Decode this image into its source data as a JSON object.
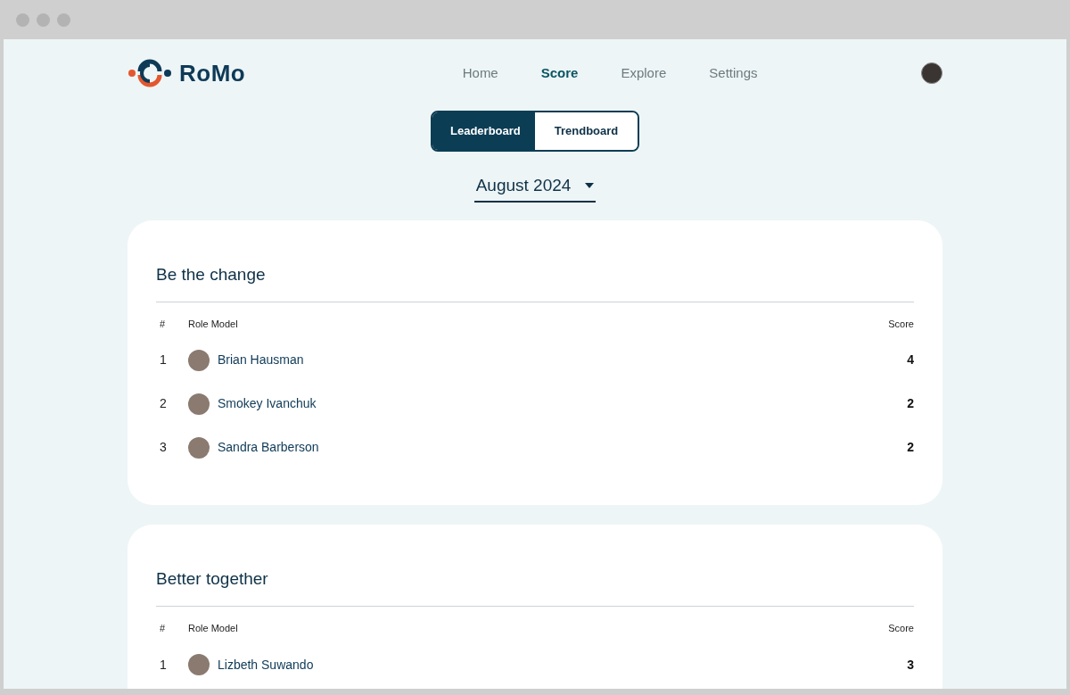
{
  "brand": {
    "name": "RoMo"
  },
  "nav": [
    {
      "label": "Home",
      "selected": false
    },
    {
      "label": "Score",
      "selected": true
    },
    {
      "label": "Explore",
      "selected": false
    },
    {
      "label": "Settings",
      "selected": false
    }
  ],
  "tabs": [
    {
      "label": "Leaderboard",
      "selected": true
    },
    {
      "label": "Trendboard",
      "selected": false
    }
  ],
  "period": {
    "value": "August 2024"
  },
  "boards": [
    {
      "title": "Be the change",
      "columns": [
        "#",
        "Role Model",
        "Score"
      ],
      "rows": [
        {
          "rank": "1",
          "name": "Brian Hausman",
          "score": "4"
        },
        {
          "rank": "2",
          "name": "Smokey Ivanchuk",
          "score": "2"
        },
        {
          "rank": "3",
          "name": "Sandra Barberson",
          "score": "2"
        }
      ]
    },
    {
      "title": "Better together",
      "columns": [
        "#",
        "Role Model",
        "Score"
      ],
      "rows": [
        {
          "rank": "1",
          "name": "Lizbeth Suwando",
          "score": "3"
        }
      ]
    }
  ]
}
